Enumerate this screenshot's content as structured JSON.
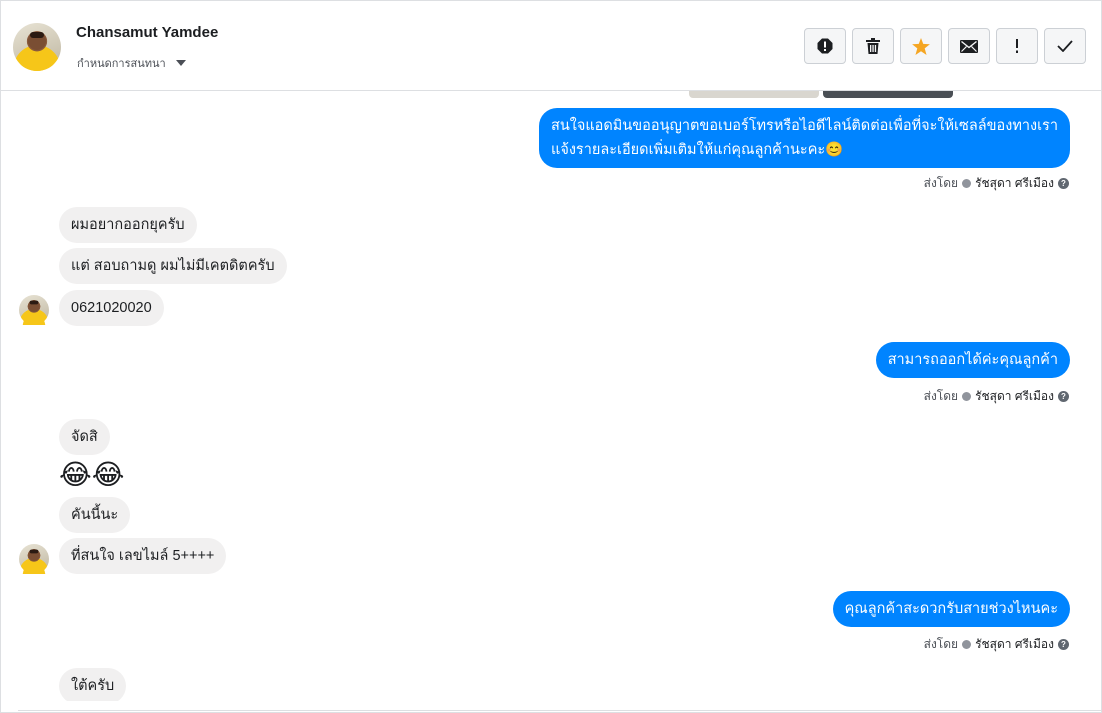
{
  "header": {
    "contact_name": "Chansamut Yamdee",
    "assign_label": "กำหนดการสนทนา"
  },
  "toolbar": {
    "buttons": [
      {
        "name": "report-spam-button",
        "icon": "alert-octagon-icon"
      },
      {
        "name": "delete-button",
        "icon": "trash-icon"
      },
      {
        "name": "star-button",
        "icon": "star-icon",
        "color": "#f5a623"
      },
      {
        "name": "mark-unread-button",
        "icon": "envelope-icon"
      },
      {
        "name": "follow-up-button",
        "icon": "exclamation-icon"
      },
      {
        "name": "mark-done-button",
        "icon": "checkmark-icon"
      }
    ]
  },
  "colors": {
    "outgoing_bubble": "#0084ff",
    "incoming_bubble": "#f1f0f0"
  },
  "messages": {
    "out1_line1": "สนใจแอดมินขออนุญาตขอเบอร์โทรหรือไอดีไลน์ติดต่อเพื่อที่จะให้เซลล์ของทางเรา",
    "out1_line2": "แจ้งรายละเอียดเพิ่มเติมให้แก่คุณลูกค้านะคะ😊",
    "in1": "ผมอยากออกยุครับ",
    "in2": "แต่  สอบถามดู  ผมไม่มีเคตดิตครับ",
    "in3": "0621020020",
    "out2": "สามารถออกได้ค่ะคุณลูกค้า",
    "in4": "จัดสิ",
    "in5": "😂😂",
    "in6": "คันนี้นะ",
    "in7": "ที่สนใจ  เลขไมล์  5++++",
    "out3": "คุณลูกค้าสะดวกรับสายช่วงไหนคะ",
    "in8": "ใต้ครับ"
  },
  "sent_by": {
    "prefix": "ส่งโดย",
    "agent": "รัชสุดา ศรีเมือง"
  }
}
